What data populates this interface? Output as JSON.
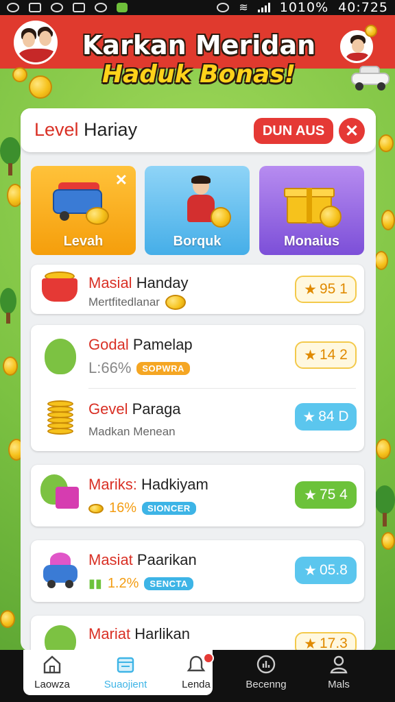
{
  "status_bar": {
    "battery": "1010%",
    "time": "40:725"
  },
  "header": {
    "title_line1": "Karkan Meridan",
    "title_line2": "Haduk Bonas!"
  },
  "panel": {
    "title_prefix": "Level",
    "title_rest": " Hariay",
    "action_button": "DUN AUS",
    "close_symbol": "✕"
  },
  "tiles": [
    {
      "label": "Levah",
      "color": "#f59e0b",
      "icon": "truck-icon"
    },
    {
      "label": "Borquk",
      "color": "#45aee8",
      "icon": "person-icon"
    },
    {
      "label": "Monaius",
      "color": "#7c4fd8",
      "icon": "gift-icon"
    }
  ],
  "items": [
    {
      "title_prefix": "Masial",
      "title_rest": " Handay",
      "sub": "Mertfitedlanar",
      "score": "95 1",
      "score_style": "gold",
      "icon": "basket-icon"
    },
    {
      "title_prefix": "Godal",
      "title_rest": " Pamelap",
      "sub": "L:66%",
      "tag": "SOPWRA",
      "score": "14 2",
      "score_style": "gold",
      "icon": "monster-icon"
    },
    {
      "title_prefix": "Gevel",
      "title_rest": " Paraga",
      "sub": "Madkan Menean",
      "score": "84 D",
      "score_style": "teal",
      "icon": "coin-stack-icon"
    },
    {
      "title_prefix": "Mariks:",
      "title_rest": " Hadkiyam",
      "sub": "16%",
      "tag": "SIONCER",
      "score": "75 4",
      "score_style": "lime",
      "icon": "gift-monster-icon"
    },
    {
      "title_prefix": "Masiat",
      "title_rest": " Paarikan",
      "sub": "1.2%",
      "tag": "SENCTA",
      "score": "05.8",
      "score_style": "teal",
      "icon": "robot-icon"
    },
    {
      "title_prefix": "Mariat",
      "title_rest": " Harlikan",
      "score": "17.3",
      "score_style": "gold",
      "icon": "monster-icon"
    }
  ],
  "nav": [
    {
      "label": "Laowza",
      "icon": "home-icon"
    },
    {
      "label": "Suaojient",
      "icon": "calendar-icon"
    },
    {
      "label": "Lenda",
      "icon": "bell-icon"
    },
    {
      "label": "Becenng",
      "icon": "chart-icon"
    },
    {
      "label": "Mals",
      "icon": "profile-icon"
    }
  ],
  "colors": {
    "header_red": "#e03a2e",
    "grass": "#7cc242",
    "accent_red": "#e53935",
    "gold": "#f6c21c"
  }
}
